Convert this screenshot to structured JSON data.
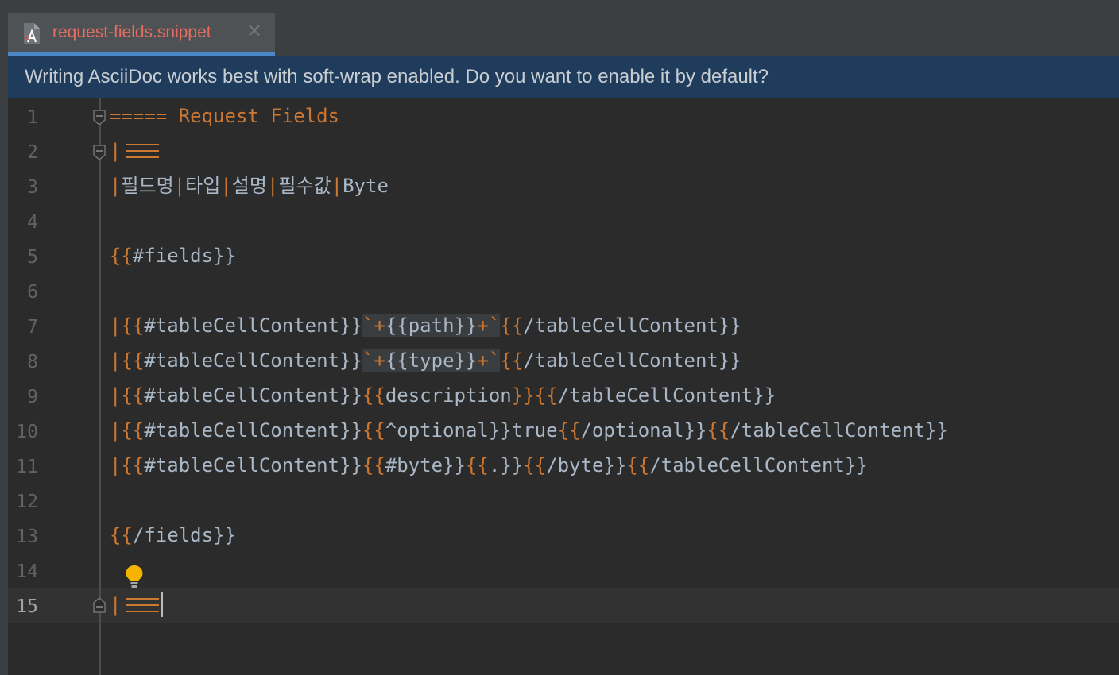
{
  "tab": {
    "label": "request-fields.snippet",
    "close": "✕"
  },
  "banner": {
    "text": "Writing AsciiDoc works best with soft-wrap enabled. Do you want to enable it by default?"
  },
  "editor": {
    "line_numbers": [
      "1",
      "2",
      "3",
      "4",
      "5",
      "6",
      "7",
      "8",
      "9",
      "10",
      "11",
      "12",
      "13",
      "14",
      "15"
    ],
    "current_line": "15",
    "code": {
      "l1": "===== Request Fields",
      "l3": {
        "pipe": "|",
        "c1": "필드명",
        "c2": "타입",
        "c3": "설명",
        "c4": "필수값",
        "c5": "Byte"
      },
      "l5": {
        "open": "{{",
        "name": "#fields",
        "close": "}}"
      },
      "l7": {
        "pipe": "|",
        "o1": "{{",
        "t1": "#tableCellContent",
        "c1": "}}",
        "bt": "`",
        "plus": "+",
        "o2": "{{",
        "t2": "path",
        "c2": "}}",
        "plus2": "+",
        "bt2": "`",
        "o3": "{{",
        "t3": "/tableCellContent",
        "c3": "}}"
      },
      "l8": {
        "pipe": "|",
        "o1": "{{",
        "t1": "#tableCellContent",
        "c1": "}}",
        "bt": "`",
        "plus": "+",
        "o2": "{{",
        "t2": "type",
        "c2": "}}",
        "plus2": "+",
        "bt2": "`",
        "o3": "{{",
        "t3": "/tableCellContent",
        "c3": "}}"
      },
      "l9": {
        "pipe": "|",
        "o1": "{{",
        "t1": "#tableCellContent",
        "c1": "}}",
        "o2": "{{",
        "t2": "description",
        "c2": "}}",
        "o3": "{{",
        "t3": "/tableCellContent",
        "c3": "}}"
      },
      "l10": {
        "pipe": "|",
        "o1": "{{",
        "t1": "#tableCellContent",
        "c1": "}}",
        "o2": "{{",
        "t2": "^optional",
        "c2": "}}",
        "val": "true",
        "o3": "{{",
        "t3": "/optional",
        "c3": "}}",
        "o4": "{{",
        "t4": "/tableCellContent",
        "c4": "}}"
      },
      "l11": {
        "pipe": "|",
        "o1": "{{",
        "t1": "#tableCellContent",
        "c1": "}}",
        "o2": "{{",
        "t2": "#byte",
        "c2": "}}",
        "o3": "{{",
        "t3": ".",
        "c3": "}}",
        "o4": "{{",
        "t4": "/byte",
        "c4": "}}",
        "o5": "{{",
        "t5": "/tableCellContent",
        "c5": "}}"
      },
      "l13": {
        "open": "{{",
        "name": "/fields",
        "close": "}}"
      }
    }
  },
  "colors": {
    "keyword": "#cc7832",
    "text": "#a9b7c6",
    "banner_bg": "#1f3c5c",
    "tab_label": "#e56d61",
    "tab_underline": "#4a88c7"
  },
  "icons": {
    "file_icon": "asciidoc-file-icon",
    "close": "close-icon",
    "intention": "lightbulb-icon"
  }
}
